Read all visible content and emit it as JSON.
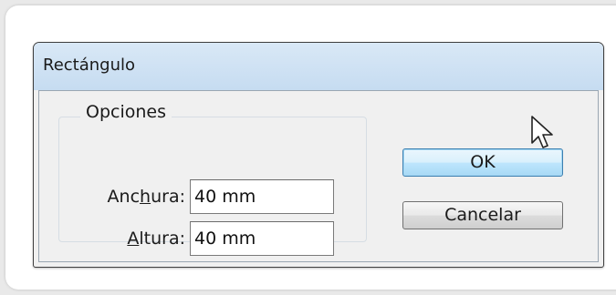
{
  "dialog": {
    "title": "Rectángulo",
    "group": {
      "label": "Opciones"
    },
    "fields": [
      {
        "label_pre": "Anc",
        "label_mnemonic": "h",
        "label_post": "ura:",
        "value": "40 mm"
      },
      {
        "label_pre": "",
        "label_mnemonic": "A",
        "label_post": "ltura:",
        "value": "40 mm"
      }
    ],
    "buttons": {
      "ok": "OK",
      "cancel": "Cancelar"
    }
  },
  "icons": {
    "cursor": "mouse-pointer-icon"
  }
}
